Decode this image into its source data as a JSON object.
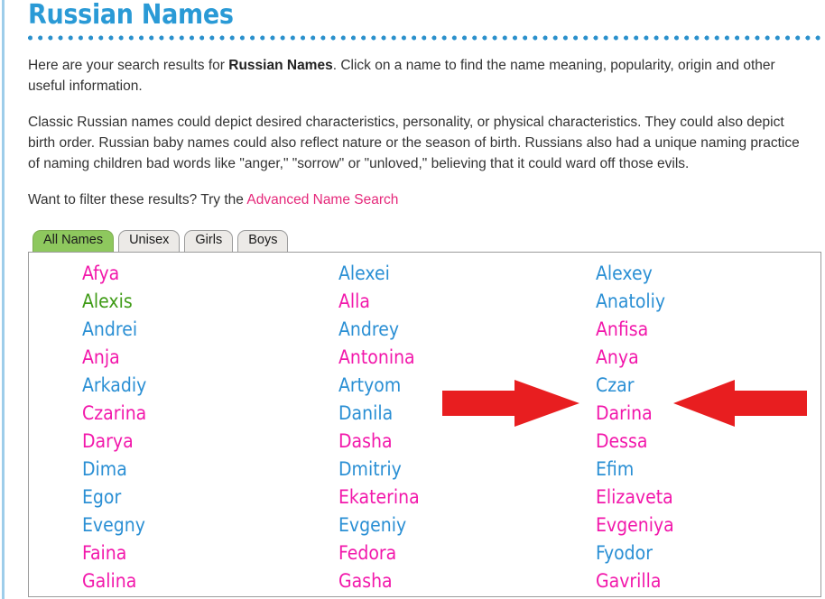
{
  "page": {
    "title": "Russian Names",
    "accent_blue": "#2a9ad6",
    "accent_pink": "#e5287a",
    "boy_color": "#2a8fd4",
    "girl_color": "#f218ab",
    "unisex_color": "#3f9b16",
    "annotation_color": "#e81e20"
  },
  "intro": {
    "before_bold": "Here are your search results for ",
    "bold": "Russian Names",
    "after_bold": ". Click on a name to find the name meaning, popularity, origin and other useful information."
  },
  "description": {
    "text": "Classic Russian names could depict desired characteristics, personality, or physical characteristics. They could also depict birth order. Russian baby names could also reflect nature or the season of birth. Russians also had a unique naming practice of naming children bad words like \"anger,\" \"sorrow\" or \"unloved,\" believing that it could ward off those evils."
  },
  "filter": {
    "prompt": "Want to filter these results? Try the ",
    "link_label": "Advanced Name Search"
  },
  "tabs": [
    {
      "label": "All Names",
      "active": true
    },
    {
      "label": "Unisex",
      "active": false
    },
    {
      "label": "Girls",
      "active": false
    },
    {
      "label": "Boys",
      "active": false
    }
  ],
  "names": {
    "columns": [
      [
        {
          "name": "Afya",
          "gender": "girl"
        },
        {
          "name": "Alexis",
          "gender": "unisex"
        },
        {
          "name": "Andrei",
          "gender": "boy"
        },
        {
          "name": "Anja",
          "gender": "girl"
        },
        {
          "name": "Arkadiy",
          "gender": "boy"
        },
        {
          "name": "Czarina",
          "gender": "girl"
        },
        {
          "name": "Darya",
          "gender": "girl"
        },
        {
          "name": "Dima",
          "gender": "boy"
        },
        {
          "name": "Egor",
          "gender": "boy"
        },
        {
          "name": "Evegny",
          "gender": "boy"
        },
        {
          "name": "Faina",
          "gender": "girl"
        },
        {
          "name": "Galina",
          "gender": "girl"
        }
      ],
      [
        {
          "name": "Alexei",
          "gender": "boy"
        },
        {
          "name": "Alla",
          "gender": "girl"
        },
        {
          "name": "Andrey",
          "gender": "boy"
        },
        {
          "name": "Antonina",
          "gender": "girl"
        },
        {
          "name": "Artyom",
          "gender": "boy"
        },
        {
          "name": "Danila",
          "gender": "boy"
        },
        {
          "name": "Dasha",
          "gender": "girl"
        },
        {
          "name": "Dmitriy",
          "gender": "boy"
        },
        {
          "name": "Ekaterina",
          "gender": "girl"
        },
        {
          "name": "Evgeniy",
          "gender": "boy"
        },
        {
          "name": "Fedora",
          "gender": "girl"
        },
        {
          "name": "Gasha",
          "gender": "girl"
        }
      ],
      [
        {
          "name": "Alexey",
          "gender": "boy"
        },
        {
          "name": "Anatoliy",
          "gender": "boy"
        },
        {
          "name": "Anfisa",
          "gender": "girl"
        },
        {
          "name": "Anya",
          "gender": "girl"
        },
        {
          "name": "Czar",
          "gender": "boy"
        },
        {
          "name": "Darina",
          "gender": "girl"
        },
        {
          "name": "Dessa",
          "gender": "girl"
        },
        {
          "name": "Efim",
          "gender": "boy"
        },
        {
          "name": "Elizaveta",
          "gender": "girl"
        },
        {
          "name": "Evgeniya",
          "gender": "girl"
        },
        {
          "name": "Fyodor",
          "gender": "boy"
        },
        {
          "name": "Gavrilla",
          "gender": "girl"
        }
      ]
    ]
  },
  "annotations": {
    "arrows": [
      {
        "name": "left-arrow-to-czar",
        "direction": "right",
        "target": "Czar"
      },
      {
        "name": "right-arrow-to-czar",
        "direction": "left",
        "target": "Czar"
      }
    ]
  }
}
